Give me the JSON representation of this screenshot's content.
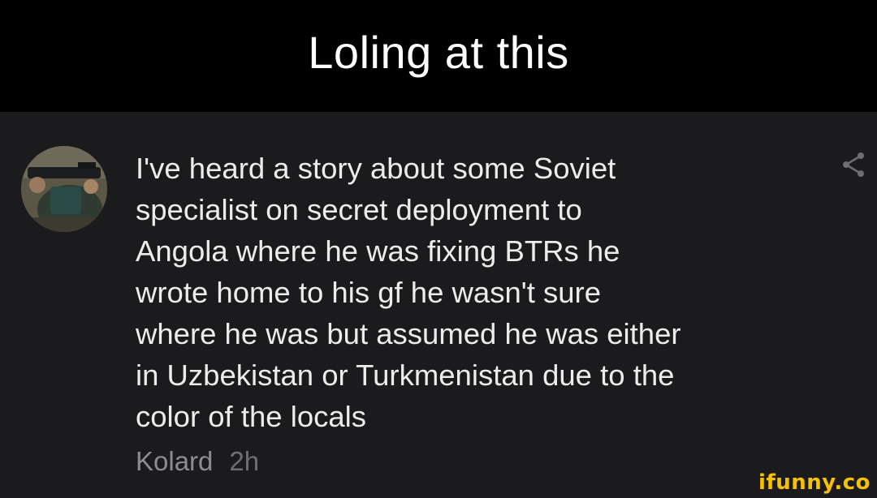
{
  "caption": {
    "title": "Loling at this"
  },
  "comment": {
    "text": "I've heard a story about some Soviet\nspecialist on secret deployment to\nAngola where he was fixing BTRs he\nwrote home to his gf he wasn't sure\nwhere he was but assumed he was either\nin Uzbekistan or Turkmenistan due to the\ncolor of the locals",
    "author": "Kolard",
    "time": "2h",
    "share_icon": "share-icon",
    "avatar_icon": "avatar"
  },
  "watermark": {
    "text": "ifunny.co"
  },
  "colors": {
    "caption_bg": "#000000",
    "comment_bg": "#1b1b1d",
    "text": "#ececec",
    "meta": "#8d8d91",
    "brand": "#f7c100"
  }
}
